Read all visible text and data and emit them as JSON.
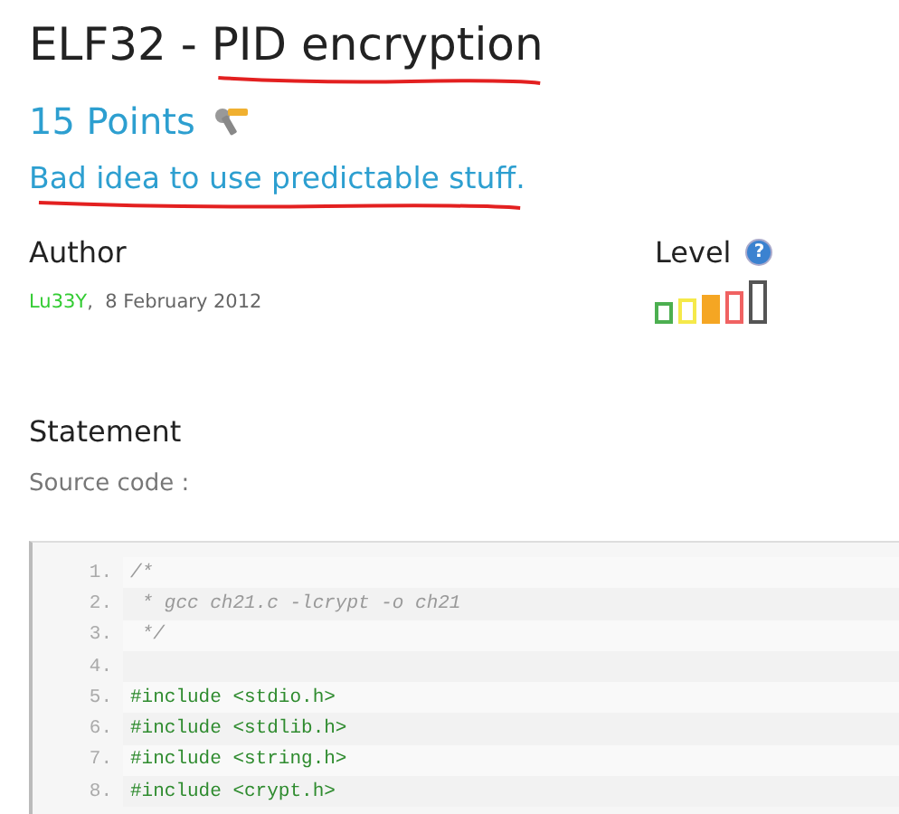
{
  "title": {
    "prefix": "ELF32 - ",
    "underlined": "PID encryption"
  },
  "points": "15 Points",
  "tagline": "Bad idea to use predictable stuff.",
  "author": {
    "heading": "Author",
    "name": "Lu33Y",
    "date": ",  8 February 2012"
  },
  "level": {
    "heading": "Level",
    "help": "?",
    "bars": [
      {
        "color": "#4caf50",
        "filled": false
      },
      {
        "color": "#f5e94a",
        "filled": false
      },
      {
        "color": "#f5a623",
        "filled": true
      },
      {
        "color": "#f06262",
        "filled": false
      },
      {
        "color": "#555555",
        "filled": false
      }
    ]
  },
  "statement": {
    "heading": "Statement",
    "intro": "Source code :"
  },
  "code": [
    {
      "number": "1.",
      "kind": "comment",
      "text": "/*"
    },
    {
      "number": "2.",
      "kind": "comment",
      "text": " * gcc ch21.c -lcrypt -o ch21"
    },
    {
      "number": "3.",
      "kind": "comment",
      "text": " */"
    },
    {
      "number": "4.",
      "kind": "blank"
    },
    {
      "number": "5.",
      "kind": "include",
      "text": "#include <stdio.h>"
    },
    {
      "number": "6.",
      "kind": "include",
      "text": "#include <stdlib.h>"
    },
    {
      "number": "7.",
      "kind": "include",
      "text": "#include <string.h>"
    },
    {
      "number": "8.",
      "kind": "include",
      "text": "#include <crypt.h>"
    }
  ]
}
